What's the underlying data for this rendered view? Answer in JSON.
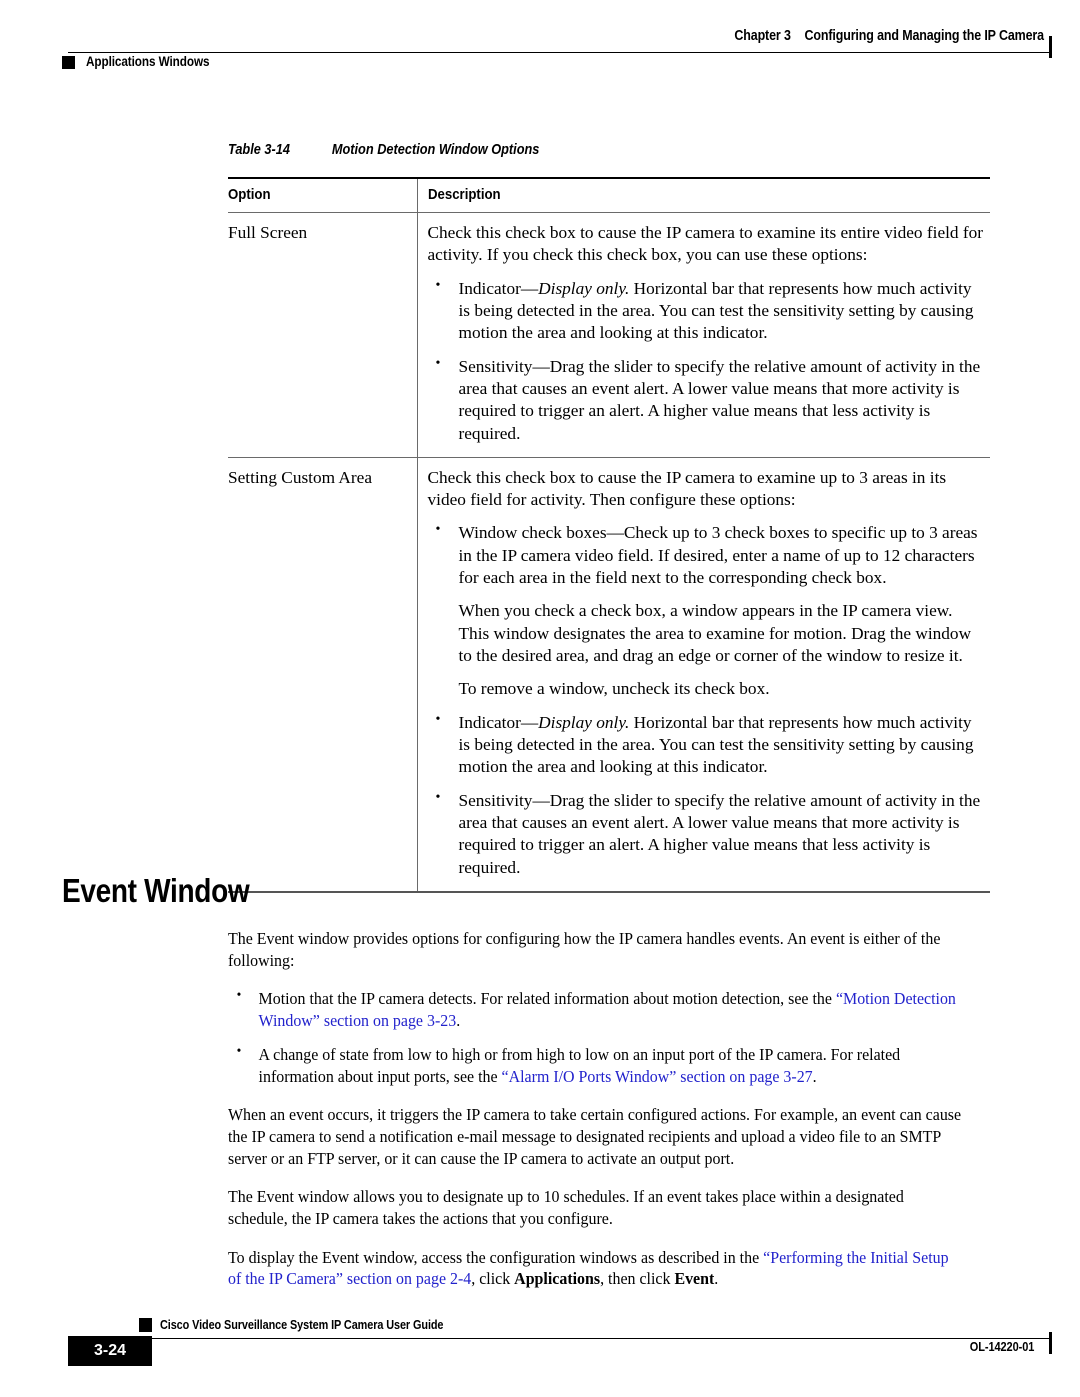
{
  "header": {
    "chapter_number": "Chapter 3",
    "chapter_title": "Configuring and Managing the IP Camera",
    "section": "Applications Windows"
  },
  "table": {
    "caption_label": "Table 3-14",
    "caption_title": "Motion Detection Window Options",
    "columns": [
      "Option",
      "Description"
    ],
    "rows": [
      {
        "option": "Full Screen",
        "intro": "Check this check box to cause the IP camera to examine its entire video field for activity. If you check this check box, you can use these options:",
        "bullets": [
          {
            "lead": "Indicator",
            "dash": "—",
            "emphasis": "Display only.",
            "text": " Horizontal bar that represents how much activity is being detected in the area. You can test the sensitivity setting by causing motion the area and looking at this indicator."
          },
          {
            "lead": "Sensitivity",
            "dash": "—",
            "emphasis": "",
            "text": "Drag the slider to specify the relative amount of activity in the area that causes an event alert. A lower value means that more activity is required to trigger an alert. A higher value means that less activity is required."
          }
        ]
      },
      {
        "option": "Setting Custom Area",
        "intro": "Check this check box to cause the IP camera to examine up to 3 areas in its video field for activity. Then configure these options:",
        "bullets": [
          {
            "lead": "Window check boxes",
            "dash": "—",
            "emphasis": "",
            "text": "Check up to 3 check boxes to specific up to 3 areas in the IP camera video field. If desired, enter a name of up to 12 characters for each area in the field next to the corresponding check box.",
            "extra_paragraphs": [
              "When you check a check box, a window appears in the IP camera view. This window designates the area to examine for motion. Drag the window to the desired area, and drag an edge or corner of the window to resize it.",
              "To remove a window, uncheck its check box."
            ]
          },
          {
            "lead": "Indicator",
            "dash": "—",
            "emphasis": "Display only.",
            "text": " Horizontal bar that represents how much activity is being detected in the area. You can test the sensitivity setting by causing motion the area and looking at this indicator."
          },
          {
            "lead": "Sensitivity",
            "dash": "—",
            "emphasis": "",
            "text": "Drag the slider to specify the relative amount of activity in the area that causes an event alert. A lower value means that more activity is required to trigger an alert. A higher value means that less activity is required."
          }
        ]
      }
    ]
  },
  "section": {
    "heading": "Event Window",
    "intro": "The Event window provides options for configuring how the IP camera handles events. An event is either of the following:",
    "bullets": [
      {
        "text_before": "Motion that the IP camera detects. For related information about motion detection, see the ",
        "link": "“Motion Detection Window” section on page 3-23",
        "text_after": "."
      },
      {
        "text_before": "A change of state from low to high or from high to low on an input port of the IP camera. For related information about input ports, see the ",
        "link": "“Alarm I/O Ports Window” section on page 3-27",
        "text_after": "."
      }
    ],
    "paragraph_2": "When an event occurs, it triggers the IP camera to take certain configured actions. For example, an event can cause the IP camera to send a notification e-mail message to designated recipients and upload a video file to an SMTP server or an FTP server, or it can cause the IP camera to activate an output port.",
    "paragraph_3": "The Event window allows you to designate up to 10 schedules. If an event takes place within a designated schedule, the IP camera takes the actions that you configure.",
    "paragraph_4": {
      "text_before": "To display the Event window, access the configuration windows as described in the ",
      "link": "“Performing the Initial Setup of the IP Camera” section on page 2-4",
      "text_mid": ", click ",
      "bold_1": "Applications",
      "text_mid_2": ", then click ",
      "bold_2": "Event",
      "text_after": "."
    }
  },
  "footer": {
    "guide_title": "Cisco Video Surveillance System IP Camera User Guide",
    "page_number": "3-24",
    "doc_id": "OL-14220-01"
  },
  "colors": {
    "link": "#2222CC",
    "text": "#000000",
    "rule": "#6a6a6a"
  }
}
